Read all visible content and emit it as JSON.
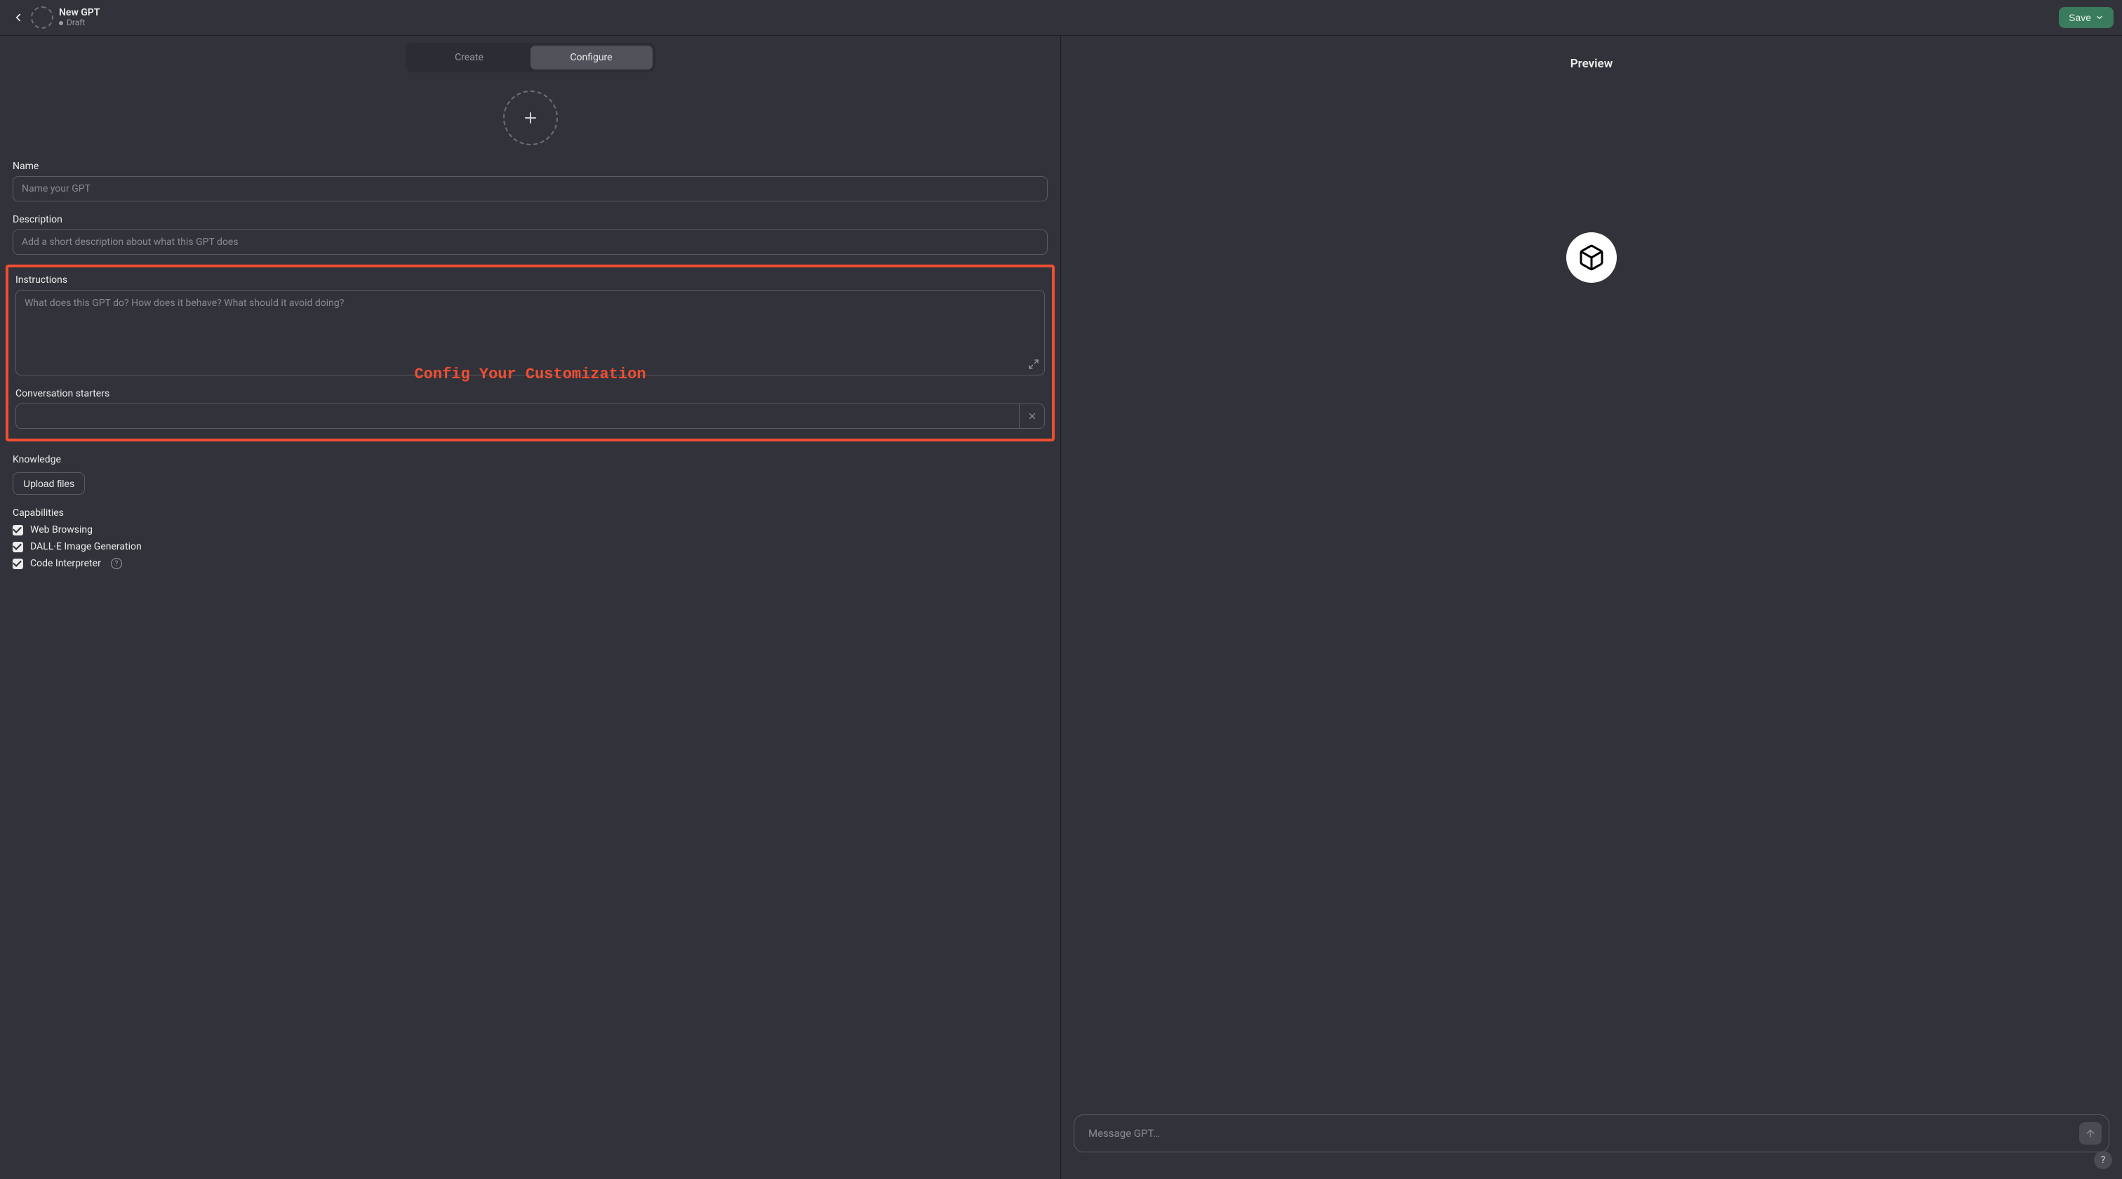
{
  "header": {
    "title": "New GPT",
    "status": "Draft",
    "save_label": "Save"
  },
  "tabs": {
    "create": "Create",
    "configure": "Configure",
    "active": "configure"
  },
  "form": {
    "name": {
      "label": "Name",
      "placeholder": "Name your GPT",
      "value": ""
    },
    "description": {
      "label": "Description",
      "placeholder": "Add a short description about what this GPT does",
      "value": ""
    },
    "instructions": {
      "label": "Instructions",
      "placeholder": "What does this GPT do? How does it behave? What should it avoid doing?",
      "value": ""
    },
    "starters": {
      "label": "Conversation starters",
      "items": [
        ""
      ]
    },
    "knowledge": {
      "label": "Knowledge",
      "upload_label": "Upload files"
    },
    "capabilities": {
      "label": "Capabilities",
      "items": [
        {
          "label": "Web Browsing",
          "checked": true
        },
        {
          "label": "DALL·E Image Generation",
          "checked": true
        },
        {
          "label": "Code Interpreter",
          "checked": true,
          "has_help": true
        }
      ]
    }
  },
  "annotation": {
    "text": "Config Your Customization"
  },
  "preview": {
    "title": "Preview",
    "message_placeholder": "Message GPT…"
  },
  "icons": {
    "back": "chevron-left-icon",
    "add": "plus-icon",
    "expand": "expand-icon",
    "close": "close-icon",
    "box": "cube-icon",
    "send": "arrow-up-icon",
    "help": "question-icon",
    "chevdown": "chevron-down-icon"
  }
}
